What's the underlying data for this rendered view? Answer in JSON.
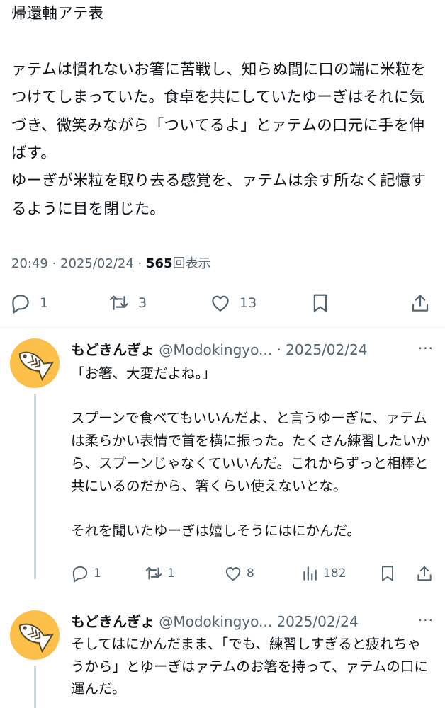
{
  "main_tweet": {
    "text": "帰還軸アテ表\n\nァテムは慣れないお箸に苦戦し、知らぬ間に口の端に米粒をつけてしまっていた。食卓を共にしていたゆーぎはそれに気づき、微笑みながら「ついてるよ」とァテムの口元に手を伸ばす。\nゆーぎが米粒を取り去る感覚を、ァテムは余す所なく記憶するように目を閉じた。",
    "time": "20:49 · 2025/02/24 · ",
    "views_count": "565",
    "views_label": "回表示",
    "replies": "1",
    "reposts": "3",
    "likes": "13"
  },
  "replies": [
    {
      "name": "もどきんぎょ",
      "handle": "@Modokingyo...",
      "date": " · 2025/02/24",
      "more": "···",
      "text": "「お箸、大変だよね。」\n\nスプーンで食べてもいいんだよ、と言うゆーぎに、ァテムは柔らかい表情で首を横に振った。たくさん練習したいから、スプーンじゃなくていいんだ。これからずっと相棒と共にいるのだから、箸くらい使えないとな。\n\nそれを聞いたゆーぎは嬉しそうにはにかんだ。",
      "reply_count": "1",
      "repost_count": "1",
      "like_count": "8",
      "view_count": "182"
    },
    {
      "name": "もどきんぎょ",
      "handle": "@Modokingyo...",
      "date": " 2025/02/24",
      "more": "···",
      "text": "そしてはにかんだまま、「でも、練習しすぎると疲れちゃうから」とゆーぎはァテムのお箸を持って、ァテムの口に運んだ。"
    }
  ],
  "colors": {
    "text": "#0f1419",
    "secondary": "#536471",
    "avatar_bg": "#fcc04a",
    "divider": "#eff3f4"
  },
  "icons": [
    "reply-icon",
    "repost-icon",
    "like-icon",
    "bookmark-icon",
    "share-icon",
    "views-icon",
    "more-icon",
    "fish-avatar-icon"
  ]
}
